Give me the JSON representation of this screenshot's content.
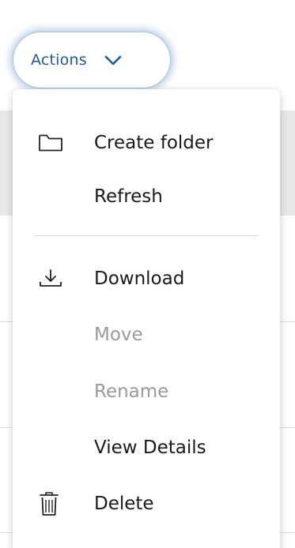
{
  "actions_button": {
    "label": "Actions",
    "chevron_icon": "chevron-down-icon"
  },
  "menu": {
    "items": [
      {
        "label": "Create folder",
        "icon": "folder-icon",
        "enabled": true
      },
      {
        "label": "Refresh",
        "icon": null,
        "enabled": true
      },
      {
        "label": "Download",
        "icon": "download-icon",
        "enabled": true
      },
      {
        "label": "Move",
        "icon": null,
        "enabled": false
      },
      {
        "label": "Rename",
        "icon": null,
        "enabled": false
      },
      {
        "label": "View Details",
        "icon": null,
        "enabled": true
      },
      {
        "label": "Delete",
        "icon": "trash-icon",
        "enabled": true
      }
    ]
  },
  "colors": {
    "accent": "#1e5a9c",
    "button_glow": "#548cc4",
    "text": "#1a1a1a",
    "text_disabled": "#9a9a9a",
    "row_highlight": "#e8e8e8"
  }
}
